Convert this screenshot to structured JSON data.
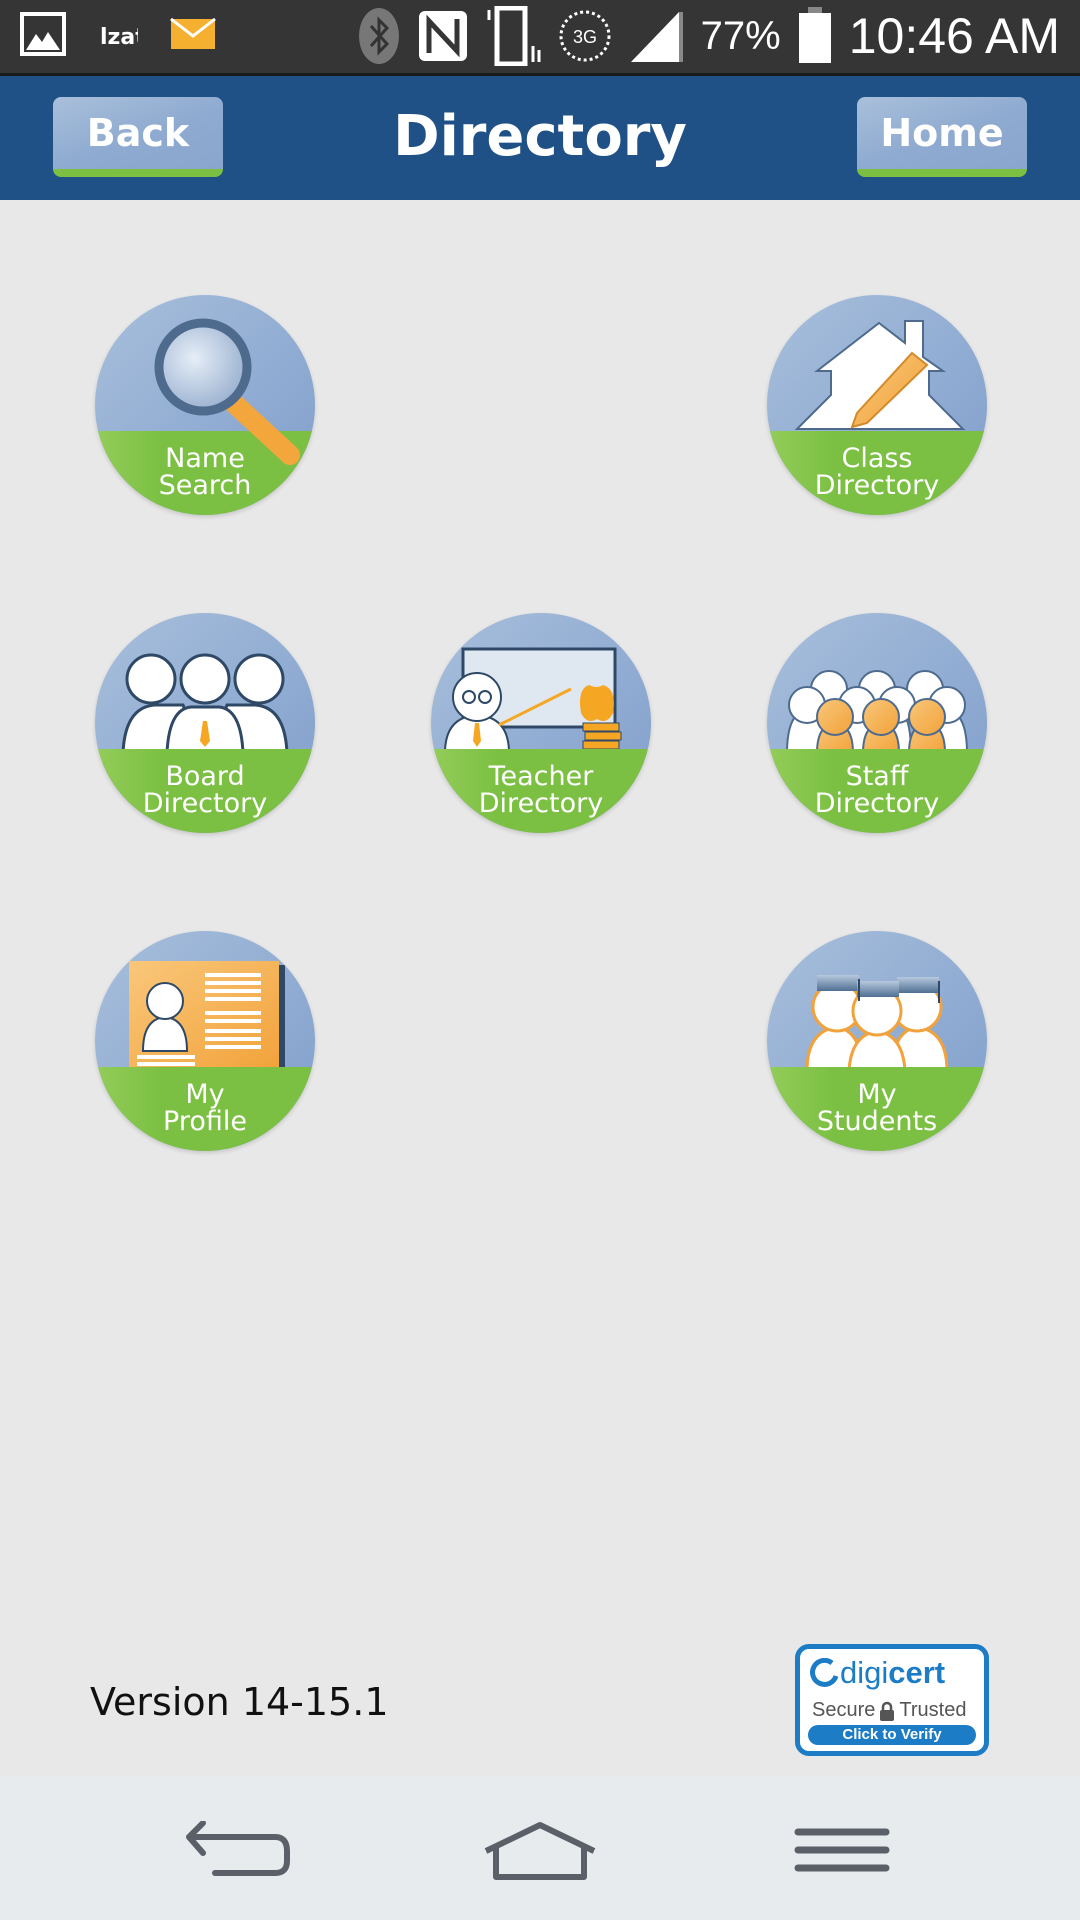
{
  "status_bar": {
    "left_icons": [
      "gallery-icon",
      "app-notification-icon",
      "email-icon"
    ],
    "right_icons": [
      "bluetooth-icon",
      "nfc-icon",
      "vibrate-icon",
      "3g-icon",
      "signal-icon",
      "battery-icon"
    ],
    "network_label": "3G",
    "battery_percent": "77%",
    "battery_level": 0.77,
    "time": "10:46 AM"
  },
  "header": {
    "title": "Directory",
    "back_label": "Back",
    "home_label": "Home"
  },
  "tiles": [
    {
      "id": "name-search",
      "line1": "Name",
      "line2": "Search",
      "icon": "magnifier-icon"
    },
    {
      "id": "class-directory",
      "line1": "Class",
      "line2": "Directory",
      "icon": "house-pencil-icon"
    },
    {
      "id": "board-directory",
      "line1": "Board",
      "line2": "Directory",
      "icon": "board-members-icon"
    },
    {
      "id": "teacher-directory",
      "line1": "Teacher",
      "line2": "Directory",
      "icon": "teacher-icon"
    },
    {
      "id": "staff-directory",
      "line1": "Staff",
      "line2": "Directory",
      "icon": "staff-group-icon"
    },
    {
      "id": "my-profile",
      "line1": "My",
      "line2": "Profile",
      "icon": "profile-card-icon"
    },
    {
      "id": "my-students",
      "line1": "My",
      "line2": "Students",
      "icon": "graduates-icon"
    }
  ],
  "footer": {
    "version": "Version 14-15.1",
    "digicert": {
      "brand_digi": "digi",
      "brand_cert": "cert",
      "secure": "Secure",
      "trusted": "Trusted",
      "verify": "Click to Verify"
    }
  },
  "nav_bar": {
    "buttons": [
      "back-nav-icon",
      "home-nav-icon",
      "menu-nav-icon"
    ]
  },
  "colors": {
    "header_bg": "#1f5187",
    "button_bg": "#8eaad0",
    "accent_green": "#7bc043",
    "tile_blue": "#8eaad2",
    "tile_green": "#7bc043",
    "orange": "#f5a623",
    "digicert_blue": "#1c7cc6"
  }
}
